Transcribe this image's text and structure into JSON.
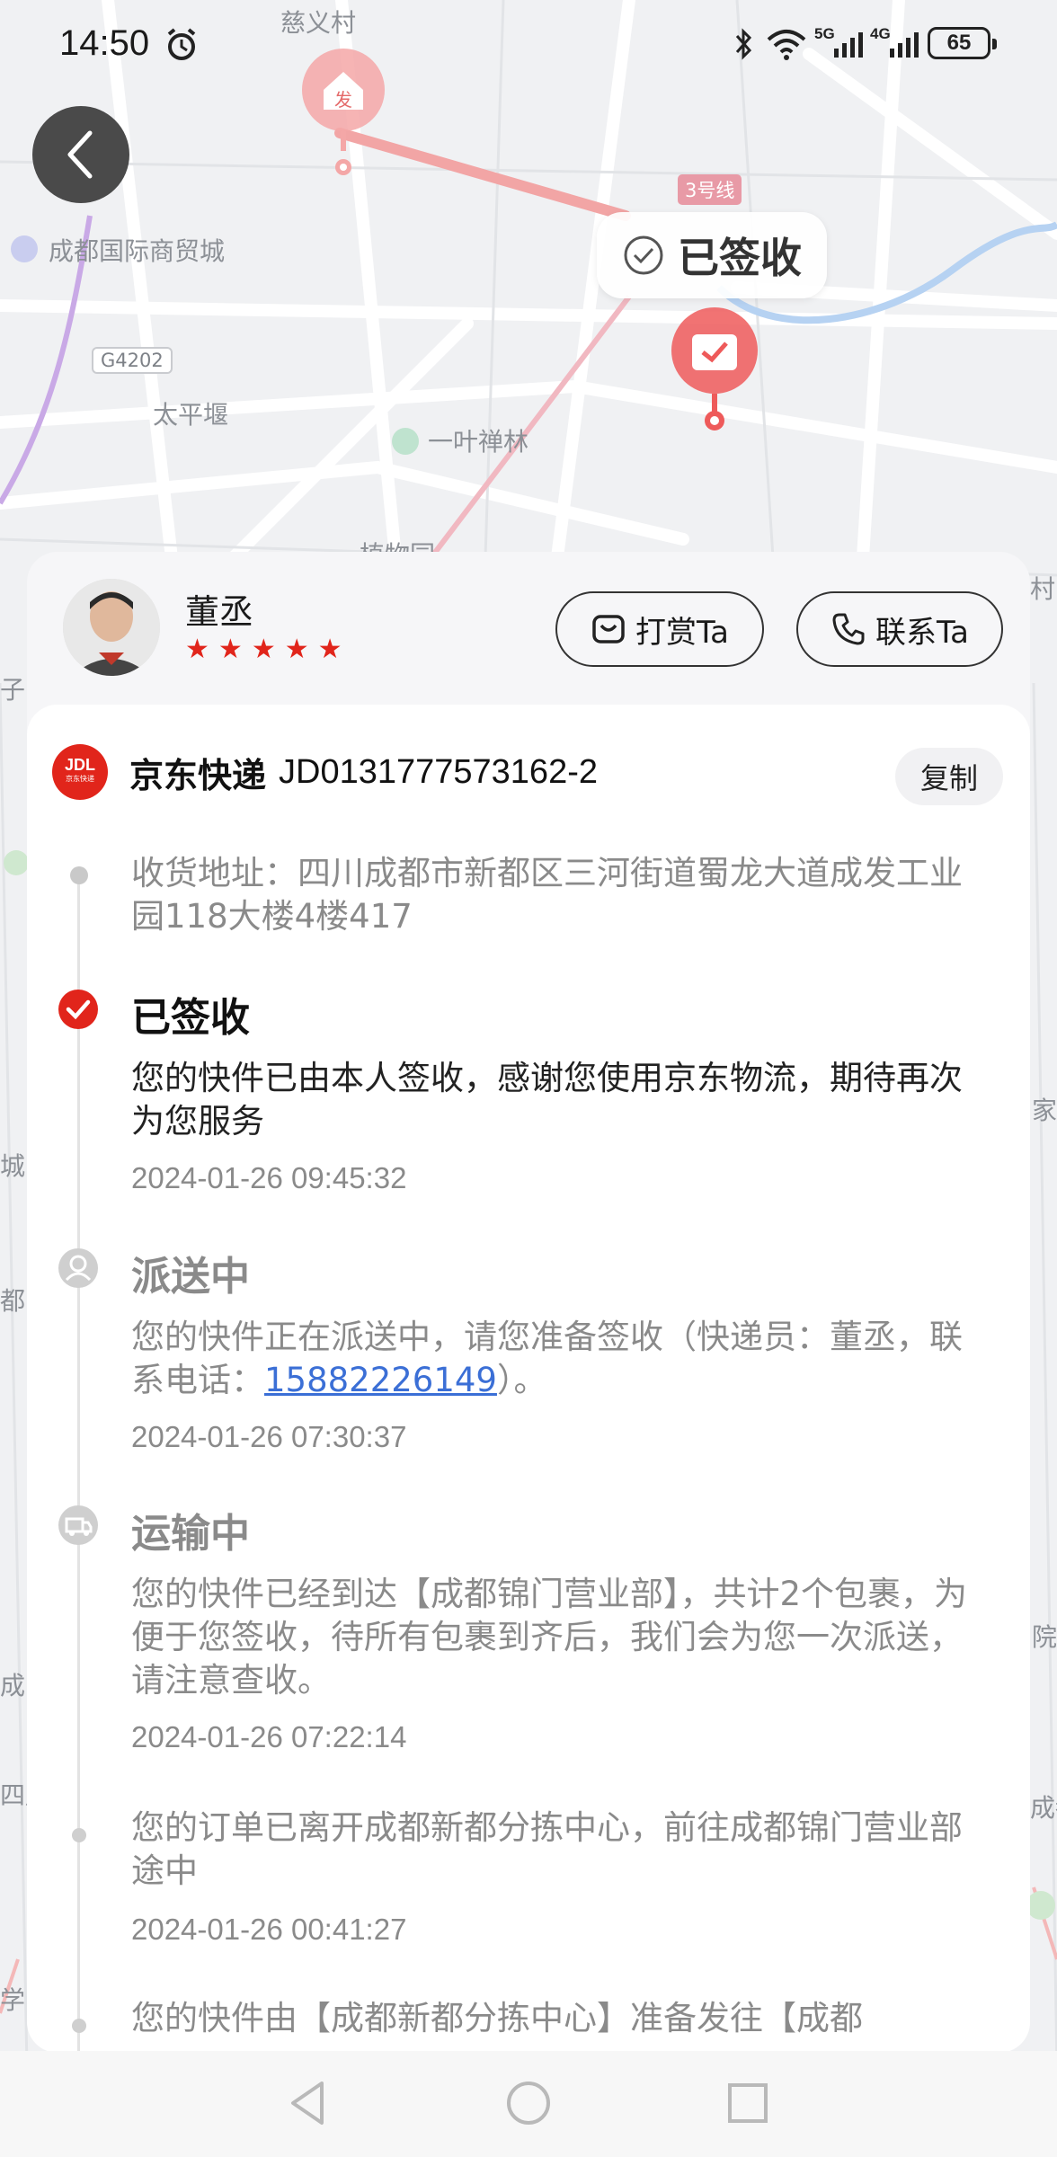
{
  "status_bar": {
    "time": "14:50",
    "network_5g": "5G",
    "network_4g": "4G",
    "battery": "65"
  },
  "map": {
    "labels": {
      "village": "慈义村",
      "trade_city": "成都国际商贸城",
      "highway": "G4202",
      "taiping": "太平堰",
      "temple": "一叶禅林",
      "botanic": "植物园",
      "metro": "3号线",
      "edge_right_1": "村",
      "edge_right_2": "家",
      "edge_right_3": "院",
      "edge_right_4": "成都",
      "edge_left_1": "子",
      "edge_left_2": "城",
      "edge_left_3": "都",
      "edge_left_4": "成",
      "edge_left_5": "四川",
      "edge_left_6": "学"
    },
    "origin_pin_text": "发",
    "status_bubble": "已签收"
  },
  "courier": {
    "name": "董丞",
    "rating": 5,
    "tip_label": "打赏Ta",
    "contact_label": "联系Ta"
  },
  "shipment": {
    "carrier_logo": "JDL",
    "carrier_logo_sub": "京东快递",
    "carrier": "京东快递",
    "tracking_number": "JD0131777573162-2",
    "copy_label": "复制",
    "address_label": "收货地址：",
    "address": "四川成都市新都区三河街道蜀龙大道成发工业园118大楼4楼417"
  },
  "events": [
    {
      "status": "已签收",
      "text": "您的快件已由本人签收，感谢您使用京东物流，期待再次为您服务",
      "time": "2024-01-26 09:45:32"
    },
    {
      "status": "派送中",
      "text_before": "您的快件正在派送中，请您准备签收（快递员：董丞，联系电话：",
      "phone": "15882226149",
      "text_after": "）。",
      "time": "2024-01-26 07:30:37"
    },
    {
      "status": "运输中",
      "text": "您的快件已经到达【成都锦门营业部】，共计2个包裹，为便于您签收，待所有包裹到齐后，我们会为您一次派送，请注意查收。",
      "time": "2024-01-26 07:22:14"
    },
    {
      "status": "",
      "text": "您的订单已离开成都新都分拣中心，前往成都锦门营业部途中",
      "time": "2024-01-26 00:41:27"
    },
    {
      "status": "",
      "text": "您的快件由【成都新都分拣中心】准备发往【成都",
      "time": ""
    }
  ],
  "colors": {
    "brand_red": "#e1251b",
    "link_blue": "#3b6fd6",
    "route_pink": "#f2a5a5"
  }
}
